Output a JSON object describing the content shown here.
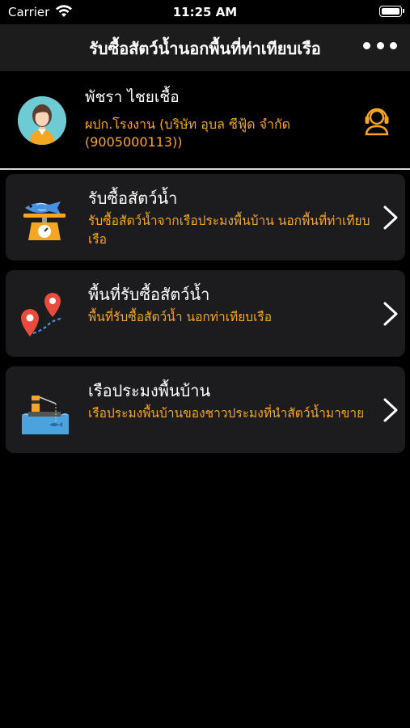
{
  "status_bar": {
    "carrier": "Carrier",
    "time": "11:25 AM"
  },
  "nav": {
    "title": "รับซื้อสัตว์น้ำนอกพื้นที่ท่าเทียบเรือ",
    "more_icon": "ellipsis-icon"
  },
  "profile": {
    "name": "พัชรา ไชยเชื้อ",
    "company": "ผปก.โรงงาน (บริษัท อุบล ซีฟู้ด จำกัด (9005000113))",
    "avatar_icon": "woman-avatar",
    "support_icon": "customer-support-icon"
  },
  "menu": [
    {
      "title": "รับซื้อสัตว์น้ำ",
      "desc": "รับซื้อสัตว์น้ำจากเรือประมงพื้นบ้าน นอกพื้นที่ท่าเทียบเรือ",
      "icon": "fish-scale-icon"
    },
    {
      "title": "พื้นที่รับซื้อสัตว์น้ำ",
      "desc": "พื้นที่รับซื้อสัตว์น้ำ นอกท่าเทียบเรือ",
      "icon": "map-pins-route-icon"
    },
    {
      "title": "เรือประมงพื้นบ้าน",
      "desc": "เรือประมงพื้นบ้านของชาวประมงที่นำสัตว์น้ำมาขาย",
      "icon": "fishing-boat-icon"
    }
  ],
  "colors": {
    "accent": "#f5a623",
    "card_bg": "#1c1c1e",
    "nav_bg": "#1c1c1c"
  }
}
